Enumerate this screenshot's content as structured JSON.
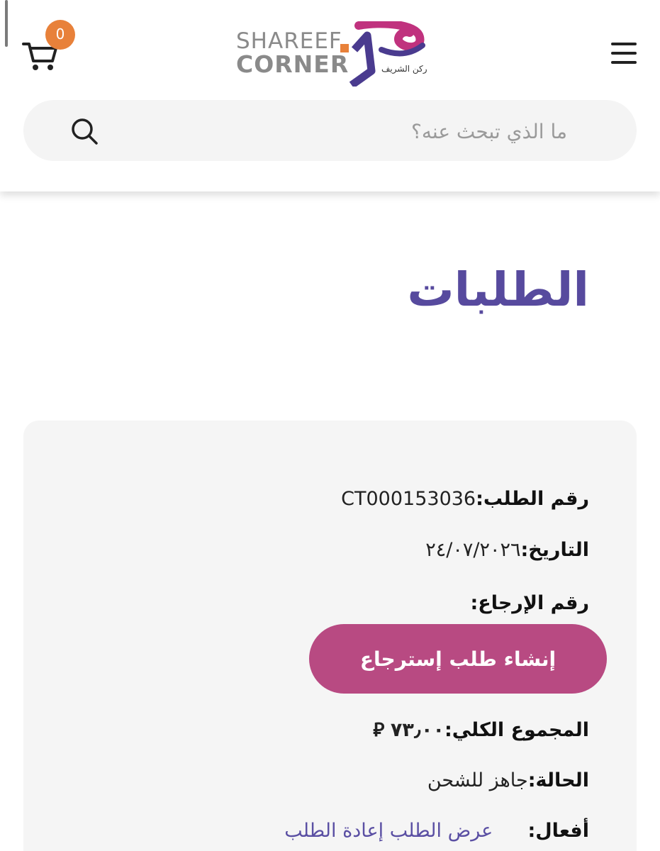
{
  "cart": {
    "count": "0"
  },
  "logo": {
    "line1": "SHAREEF",
    "line2": "CORNER",
    "arabic": "ركن الشريف"
  },
  "search": {
    "placeholder": "ما الذي تبحث عنه؟"
  },
  "page": {
    "title": "الطلبات"
  },
  "order": {
    "number_label": "رقم الطلب:",
    "number_value": "CT000153036",
    "date_label": "التاريخ:",
    "date_value": "٢٤/٠٧/٢٠٢٦",
    "return_label": "رقم الإرجاع:",
    "return_button": "إنشاء طلب إسترجاع",
    "total_label": "المجموع الكلي:",
    "total_value": "٧٣٫٠٠",
    "currency_symbol": "⃁",
    "status_label": "الحالة:",
    "status_value": "جاهز للشحن",
    "actions_label": "أفعال:",
    "action_view": "عرض الطلب",
    "action_reorder": "إعادة الطلب"
  },
  "colors": {
    "title": "#574a9e",
    "button": "#b84a82",
    "badge": "#e8813a",
    "link": "#5a4fa3",
    "logo_grey": "#8a8a8a",
    "logo_orange": "#e8813a",
    "logo_pink": "#c0327e",
    "logo_purple": "#4a3b8f"
  },
  "icons": {
    "cart": "cart-icon",
    "menu": "hamburger-menu-icon",
    "search": "search-icon"
  }
}
